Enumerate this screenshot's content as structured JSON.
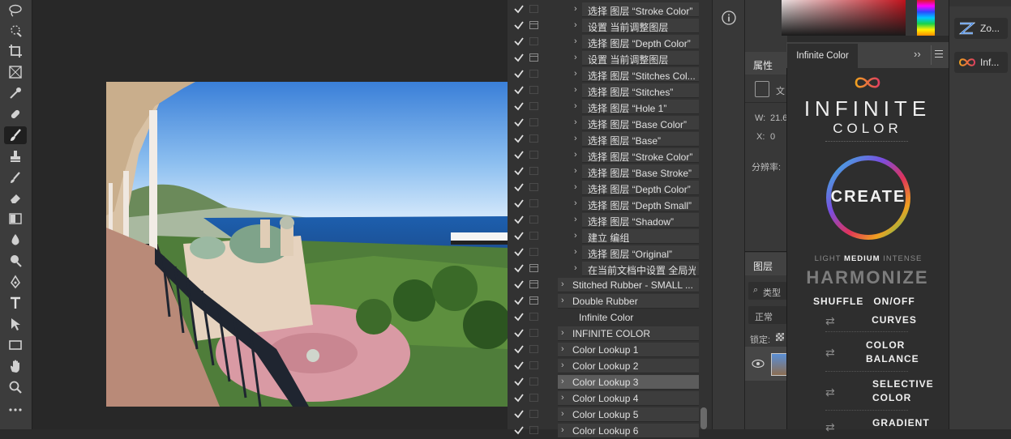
{
  "toolbar": {
    "tools": [
      "lasso-icon",
      "quick-select-icon",
      "crop-icon",
      "frame-icon",
      "eyedropper-icon",
      "healing-brush-icon",
      "brush-icon",
      "clone-stamp-icon",
      "history-brush-icon",
      "eraser-icon",
      "gradient-icon",
      "blur-icon",
      "dodge-icon",
      "pen-icon",
      "type-icon",
      "path-select-icon",
      "rectangle-icon",
      "hand-icon",
      "zoom-icon",
      "more-tools-icon"
    ],
    "selected": "brush-icon"
  },
  "actions": {
    "rows": [
      {
        "label": "选择 图层 “Stroke Color”",
        "indent": 1,
        "dialog": false
      },
      {
        "label": "设置 当前调整图层",
        "indent": 1,
        "dialog": true
      },
      {
        "label": "选择 图层 “Depth Color”",
        "indent": 1,
        "dialog": false
      },
      {
        "label": "设置 当前调整图层",
        "indent": 1,
        "dialog": true
      },
      {
        "label": "选择 图层 “Stitches Col...",
        "indent": 1,
        "dialog": false
      },
      {
        "label": "选择 图层 “Stitches”",
        "indent": 1,
        "dialog": false
      },
      {
        "label": "选择 图层 “Hole 1”",
        "indent": 1,
        "dialog": false
      },
      {
        "label": "选择 图层 “Base Color”",
        "indent": 1,
        "dialog": false
      },
      {
        "label": "选择 图层 “Base”",
        "indent": 1,
        "dialog": false
      },
      {
        "label": "选择 图层 “Stroke Color”",
        "indent": 1,
        "dialog": false
      },
      {
        "label": "选择 图层 “Base Stroke”",
        "indent": 1,
        "dialog": false
      },
      {
        "label": "选择 图层 “Depth Color”",
        "indent": 1,
        "dialog": false
      },
      {
        "label": "选择 图层 “Depth Small”",
        "indent": 1,
        "dialog": false
      },
      {
        "label": "选择 图层 “Shadow”",
        "indent": 1,
        "dialog": false
      },
      {
        "label": "建立 编组",
        "indent": 1,
        "dialog": false
      },
      {
        "label": "选择 图层 “Original”",
        "indent": 1,
        "dialog": false
      },
      {
        "label": "在当前文档中设置 全局光",
        "indent": 1,
        "dialog": true
      },
      {
        "label": "Stitched Rubber - SMALL ...",
        "indent": 0,
        "dialog": true
      },
      {
        "label": "Double Rubber",
        "indent": 0,
        "dialog": true
      },
      {
        "label": "Infinite Color",
        "indent": -1,
        "dialog": false
      },
      {
        "label": "INFINITE COLOR",
        "indent": 0,
        "dialog": false
      },
      {
        "label": "Color Lookup 1",
        "indent": 0,
        "dialog": false
      },
      {
        "label": "Color Lookup 2",
        "indent": 0,
        "dialog": false
      },
      {
        "label": "Color Lookup 3",
        "indent": 0,
        "dialog": false,
        "highlight": true
      },
      {
        "label": "Color Lookup 4",
        "indent": 0,
        "dialog": false
      },
      {
        "label": "Color Lookup 5",
        "indent": 0,
        "dialog": false
      },
      {
        "label": "Color Lookup 6",
        "indent": 0,
        "dialog": false
      }
    ]
  },
  "properties": {
    "tab": "属性",
    "doc_label": "文",
    "w_label": "W:",
    "w_value": "21.6",
    "x_label": "X:",
    "x_value": "0",
    "res_label": "分辨率:"
  },
  "layers": {
    "tab": "图层",
    "search_label": "类型",
    "blend_mode": "正常",
    "lock_label": "锁定:"
  },
  "plugin": {
    "tab_title": "Infinite Color",
    "brand_top": "INFINITE",
    "brand_bottom": "COLOR",
    "create_label": "CREATE",
    "intensity": [
      "LIGHT",
      "MEDIUM",
      "INTENSE"
    ],
    "intensity_selected": "MEDIUM",
    "harmonize_label": "HARMONIZE",
    "shuffle_label": "SHUFFLE",
    "onoff_label": "ON/OFF",
    "adjustments": [
      {
        "label1": "CURVES",
        "label2": ""
      },
      {
        "label1": "COLOR",
        "label2": "BALANCE"
      },
      {
        "label1": "SELECTIVE",
        "label2": "COLOR"
      },
      {
        "label1": "GRADIENT",
        "label2": ""
      }
    ]
  },
  "rightcol": {
    "items": [
      {
        "label": "Zo...",
        "icon": "z-logo-icon"
      },
      {
        "label": "Inf...",
        "icon": "infinity-icon"
      }
    ]
  },
  "colors": {
    "accent_orange": "#f0a020",
    "accent_red": "#e04060",
    "panel_bg": "#323232"
  }
}
